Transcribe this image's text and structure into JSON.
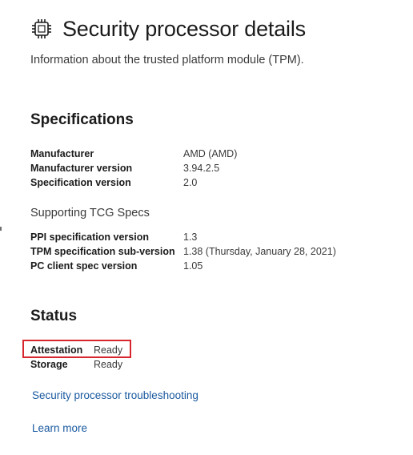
{
  "header": {
    "icon": "chip-icon",
    "title": "Security processor details",
    "subtitle": "Information about the trusted platform module (TPM)."
  },
  "specifications": {
    "heading": "Specifications",
    "rows": [
      {
        "label": "Manufacturer",
        "value": "AMD (AMD)"
      },
      {
        "label": "Manufacturer version",
        "value": "3.94.2.5"
      },
      {
        "label": "Specification version",
        "value": "2.0"
      }
    ]
  },
  "tcg": {
    "heading": "Supporting TCG Specs",
    "rows": [
      {
        "label": "PPI specification version",
        "value": "1.3"
      },
      {
        "label": "TPM specification sub-version",
        "value": "1.38 (Thursday, January 28, 2021)"
      },
      {
        "label": "PC client spec version",
        "value": "1.05"
      }
    ]
  },
  "status": {
    "heading": "Status",
    "rows": [
      {
        "label": "Attestation",
        "value": "Ready"
      },
      {
        "label": "Storage",
        "value": "Ready"
      }
    ]
  },
  "links": {
    "troubleshooting": "Security processor troubleshooting",
    "learn_more": "Learn more"
  },
  "colors": {
    "link": "#1a5aa0",
    "highlight": "#d7262e",
    "text": "#1b1b1b"
  }
}
